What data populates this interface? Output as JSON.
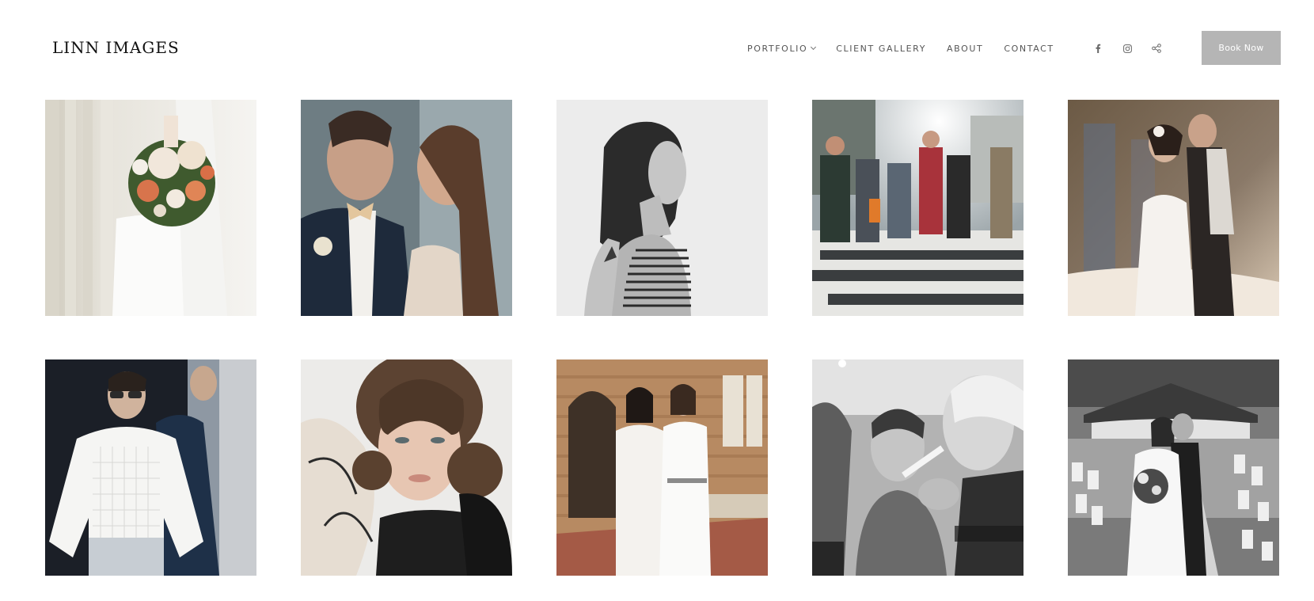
{
  "brand": {
    "logo_text": "LINN IMAGES"
  },
  "nav": {
    "items": [
      {
        "label": "PORTFOLIO",
        "has_dropdown": true
      },
      {
        "label": "CLIENT GALLERY",
        "has_dropdown": false
      },
      {
        "label": "ABOUT",
        "has_dropdown": false
      },
      {
        "label": "CONTACT",
        "has_dropdown": false
      }
    ]
  },
  "social": {
    "icons": [
      "facebook-icon",
      "instagram-icon",
      "share-icon"
    ]
  },
  "cta": {
    "label": "Book Now",
    "color": "#b5b5b5"
  },
  "gallery": {
    "tiles": [
      {
        "subject": "bridal bouquet"
      },
      {
        "subject": "couple kissing"
      },
      {
        "subject": "portrait profile black and white"
      },
      {
        "subject": "city street crosswalk"
      },
      {
        "subject": "couple embracing at sunset"
      },
      {
        "subject": "runway model"
      },
      {
        "subject": "curly hair beauty portrait"
      },
      {
        "subject": "two models in white dresses"
      },
      {
        "subject": "makeup artist backstage"
      },
      {
        "subject": "wedding ceremony kiss"
      }
    ]
  }
}
